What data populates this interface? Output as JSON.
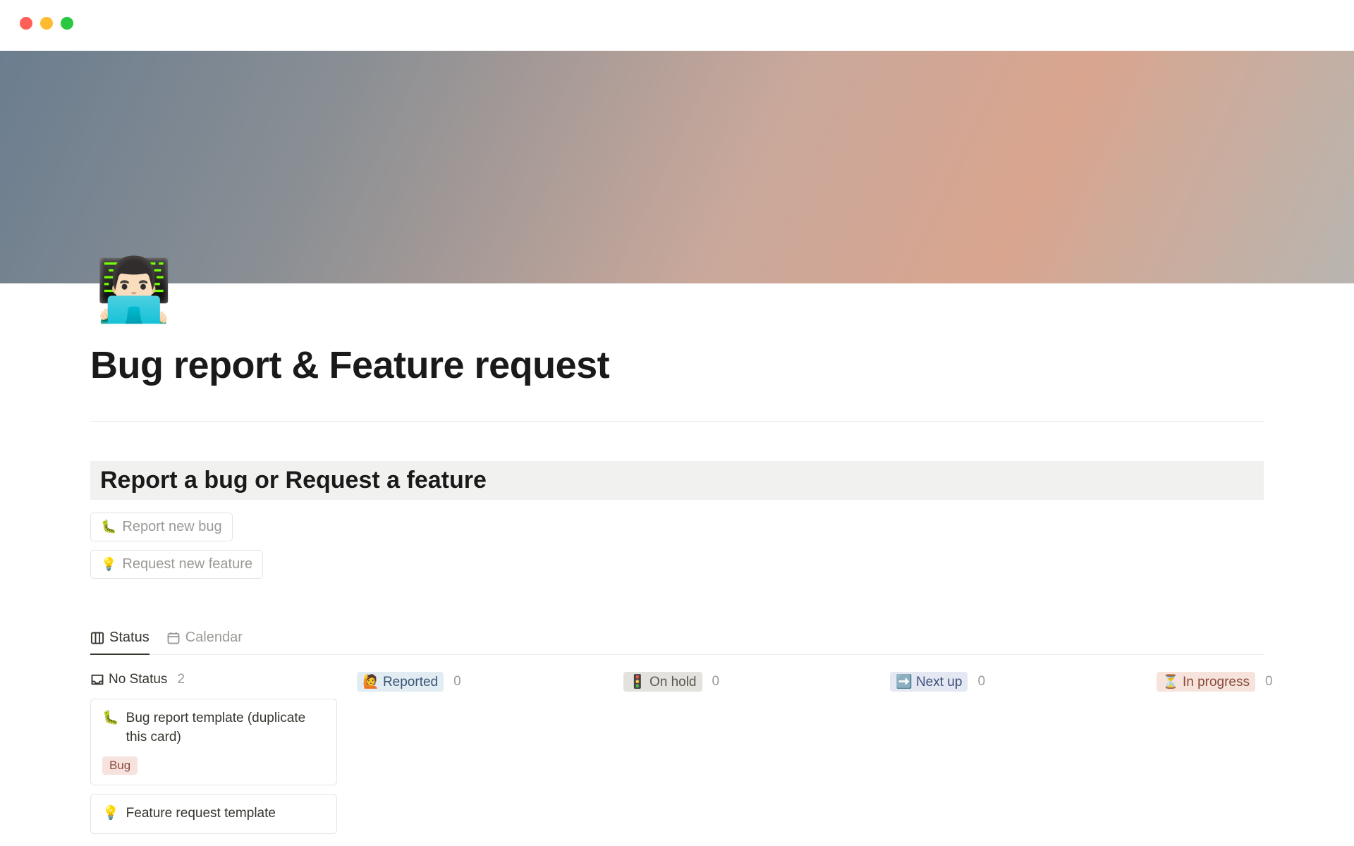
{
  "page": {
    "icon": "👨🏻‍💻",
    "title": "Bug report & Feature request"
  },
  "section": {
    "heading": "Report a bug or Request a feature"
  },
  "actions": {
    "report_bug": {
      "icon": "🐛",
      "label": "Report new bug"
    },
    "request_feature": {
      "icon": "💡",
      "label": "Request new feature"
    }
  },
  "tabs": {
    "status": "Status",
    "calendar": "Calendar"
  },
  "board": {
    "columns": [
      {
        "key": "no-status",
        "label": "No Status",
        "count": "2"
      },
      {
        "key": "reported",
        "label": "Reported",
        "count": "0",
        "icon": "🙋"
      },
      {
        "key": "on-hold",
        "label": "On hold",
        "count": "0",
        "icon": "🚦"
      },
      {
        "key": "next-up",
        "label": "Next up",
        "count": "0",
        "icon": "➡️"
      },
      {
        "key": "in-progress",
        "label": "In progress",
        "count": "0",
        "icon": "⏳"
      }
    ]
  },
  "cards": {
    "no_status": [
      {
        "icon": "🐛",
        "title": "Bug report template (duplicate this card)",
        "tag": "Bug"
      },
      {
        "icon": "💡",
        "title": "Feature request template"
      }
    ]
  }
}
